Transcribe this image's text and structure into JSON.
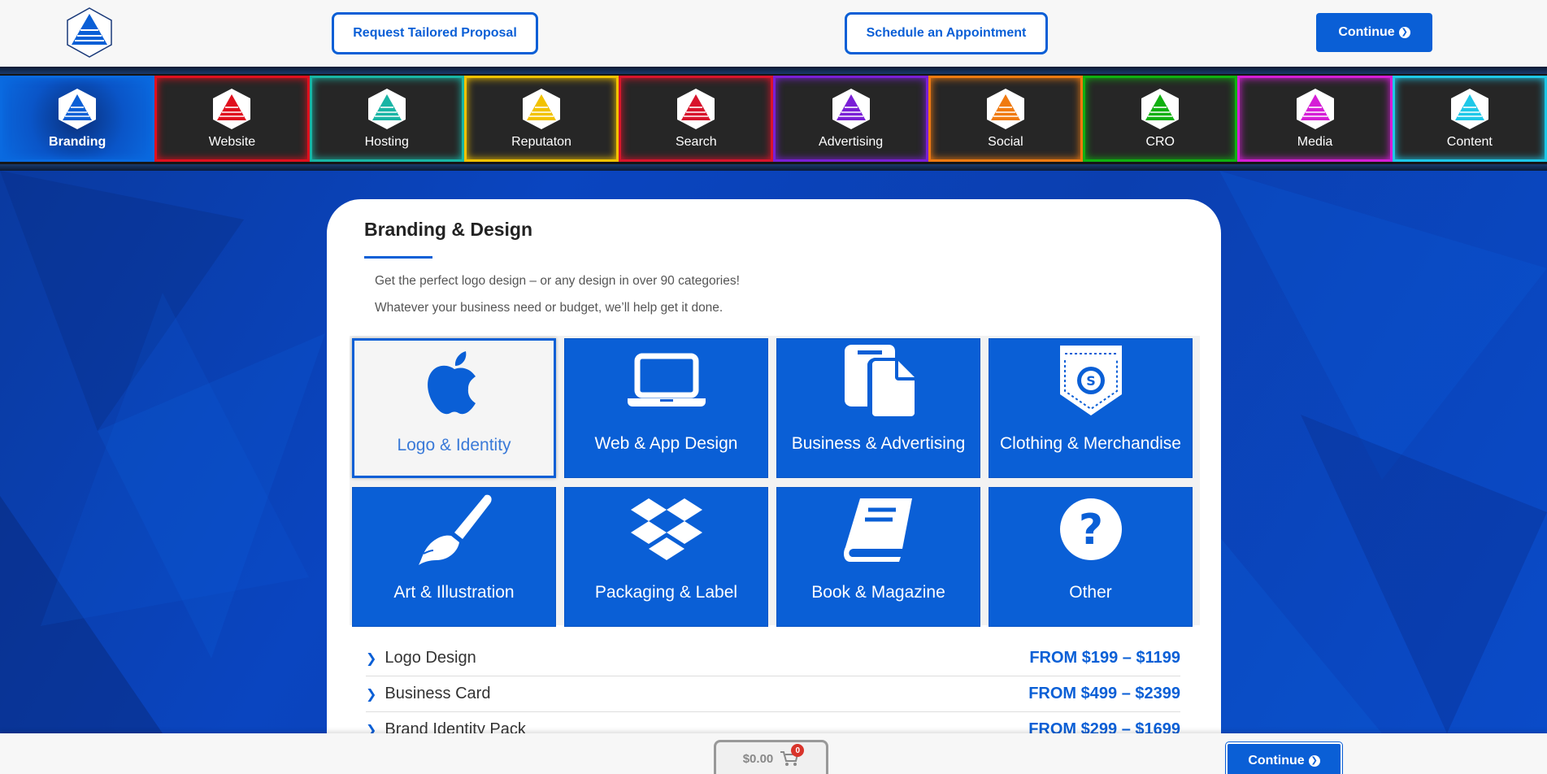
{
  "header": {
    "proposal_label": "Request Tailored Proposal",
    "appointment_label": "Schedule an Appointment",
    "continue_label": "Continue"
  },
  "nav": {
    "tabs": [
      {
        "label": "Branding",
        "color": "#0a6ae0",
        "icon_color": "#0a5fd6",
        "active": true
      },
      {
        "label": "Website",
        "color": "#e0101e",
        "icon_color": "#e0101e"
      },
      {
        "label": "Hosting",
        "color": "#19b5a5",
        "icon_color": "#19b5a5"
      },
      {
        "label": "Reputaton",
        "color": "#f2c200",
        "icon_color": "#f2c200"
      },
      {
        "label": "Search",
        "color": "#d8142c",
        "icon_color": "#d8142c"
      },
      {
        "label": "Advertising",
        "color": "#7a1fd6",
        "icon_color": "#7a1fd6"
      },
      {
        "label": "Social",
        "color": "#f07a10",
        "icon_color": "#f07a10"
      },
      {
        "label": "CRO",
        "color": "#10b010",
        "icon_color": "#10b010"
      },
      {
        "label": "Media",
        "color": "#d51ed6",
        "icon_color": "#d51ed6"
      },
      {
        "label": "Content",
        "color": "#1ec8e8",
        "icon_color": "#1ec8e8"
      }
    ]
  },
  "card": {
    "title": "Branding & Design",
    "desc_line1": "Get the perfect logo design – or any design in over 90 categories!",
    "desc_line2": "Whatever your business need or budget, we’ll help get it done.",
    "tiles": [
      {
        "label": "Logo & Identity",
        "icon": "apple-icon",
        "selected": true
      },
      {
        "label": "Web & App Design",
        "icon": "laptop-icon"
      },
      {
        "label": "Business & Advertising",
        "icon": "documents-icon"
      },
      {
        "label": "Clothing & Merchandise",
        "icon": "pocket-badge-icon"
      },
      {
        "label": "Art & Illustration",
        "icon": "paintbrush-icon"
      },
      {
        "label": "Packaging & Label",
        "icon": "dropbox-icon"
      },
      {
        "label": "Book & Magazine",
        "icon": "book-icon"
      },
      {
        "label": "Other",
        "icon": "question-icon"
      }
    ],
    "services": [
      {
        "name": "Logo Design",
        "price": "FROM $199 – $1199"
      },
      {
        "name": "Business Card",
        "price": "FROM $499 – $2399"
      },
      {
        "name": "Brand Identity Pack",
        "price": "FROM $299 – $1699"
      }
    ]
  },
  "footer": {
    "cart_total": "$0.00",
    "cart_count": "0",
    "continue_label": "Continue"
  },
  "colors": {
    "accent": "#0a5fd6"
  }
}
